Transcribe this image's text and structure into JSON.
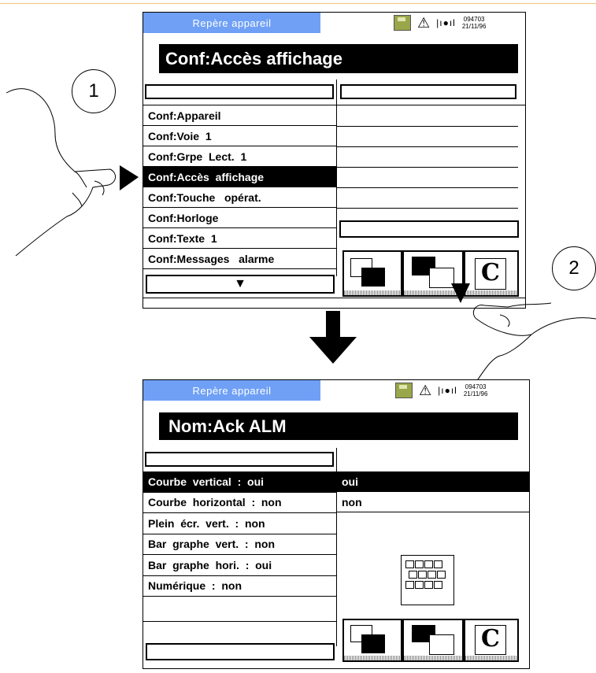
{
  "screen1": {
    "tag_label": "Repère appareil",
    "time": "094703",
    "date": "21/11/96",
    "title": "Conf:Accès affichage",
    "menu_items": [
      "Conf:Appareil",
      "Conf:Voie  1",
      "Conf:Grpe  Lect.  1",
      "Conf:Accès  affichage",
      "Conf:Touche   opérat.",
      "Conf:Horloge",
      "Conf:Texte  1",
      "Conf:Messages   alarme"
    ],
    "selected_index": 3,
    "scroll_glyph": "▼"
  },
  "screen2": {
    "tag_label": "Repère appareil",
    "time": "094703",
    "date": "21/11/96",
    "title": "Nom:Ack  ALM",
    "menu_items": [
      "Courbe  vertical  :  oui",
      "Courbe  horizontal  :  non",
      "Plein  écr.  vert.  :  non",
      "Bar  graphe  vert.  :  non",
      "Bar  graphe  hori.  :  oui",
      "Numérique  :  non"
    ],
    "selected_index": 0,
    "options": [
      "oui",
      "non"
    ],
    "selected_option": 0
  },
  "step1": "1",
  "step2": "2",
  "icons": {
    "save": "floppy-disk-icon",
    "alarm": "warning-icon",
    "signal": "signal-icon",
    "clear": "c-clear-icon",
    "keyboard": "keyboard-icon"
  },
  "colors": {
    "tag_bg": "#6fa0f5",
    "disk": "#9aa64a"
  }
}
